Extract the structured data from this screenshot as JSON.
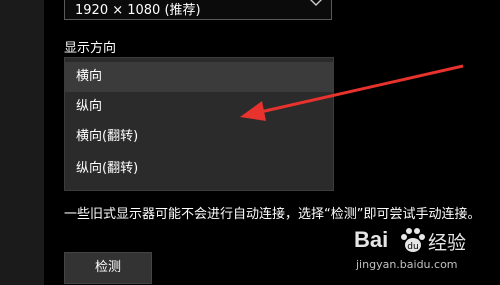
{
  "resolution_select": {
    "value": "1920 × 1080 (推荐)"
  },
  "orientation": {
    "label": "显示方向",
    "options": [
      {
        "label": "横向",
        "selected": true
      },
      {
        "label": "纵向",
        "selected": false
      },
      {
        "label": "横向(翻转)",
        "selected": false
      },
      {
        "label": "纵向(翻转)",
        "selected": false
      }
    ]
  },
  "info_text": "一些旧式显示器可能不会进行自动连接，选择“检测”即可尝试手动连接。",
  "detect_button": {
    "label": "检测"
  },
  "watermark": {
    "brand": "Bai",
    "jingyan": "经验",
    "url": "jingyan.baidu.com"
  },
  "colors": {
    "background": "#000000",
    "dropdown_bg": "#2b2b2b",
    "selected_bg": "#3b3b3b",
    "arrow": "#e8322d"
  }
}
